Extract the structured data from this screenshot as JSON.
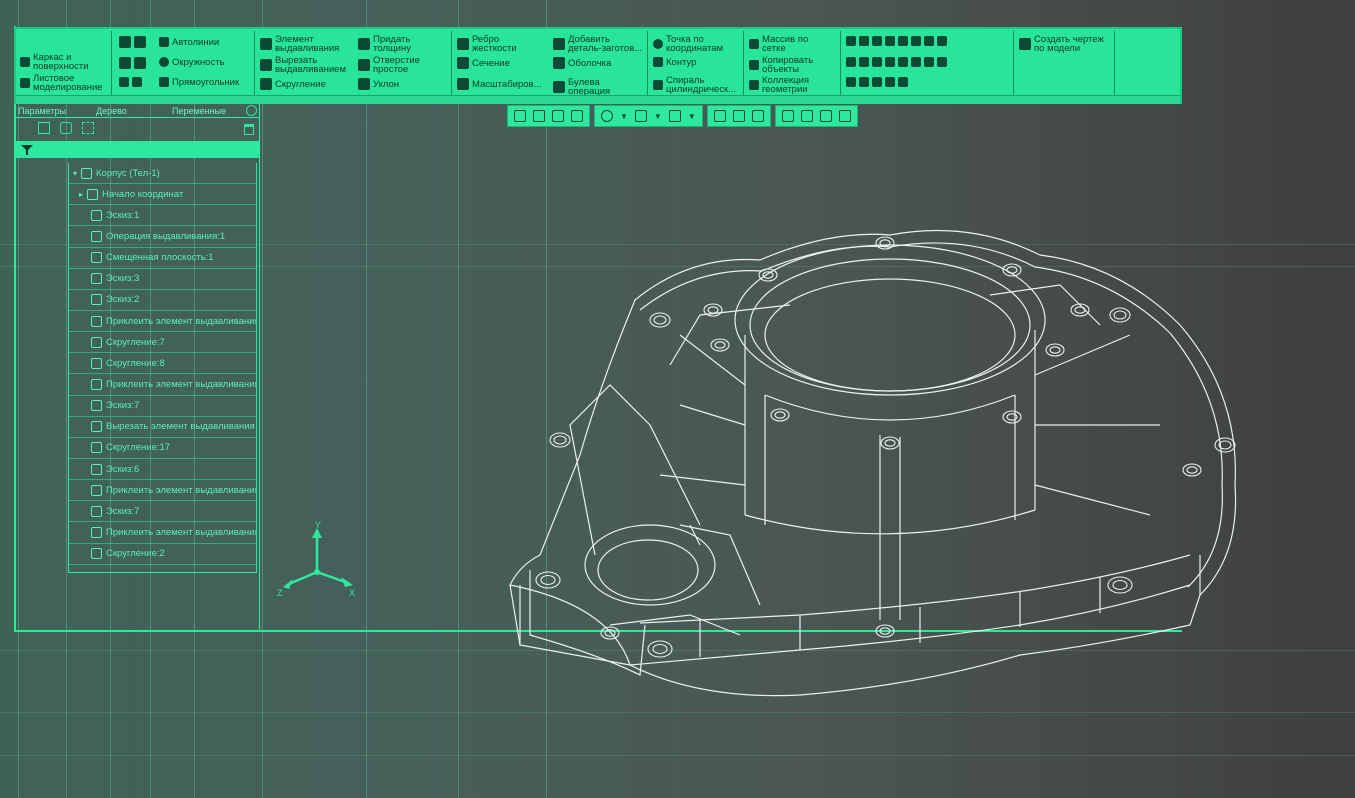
{
  "ribbon": {
    "sections": [
      {
        "items": [
          {
            "label": "Каркас и\nповерхности"
          },
          {
            "label": "Листовое\nмоделирование"
          }
        ]
      },
      {
        "items": [
          {
            "label": "Автолинии"
          },
          {
            "label": "Окружность"
          },
          {
            "label": "Прямоугольник"
          }
        ]
      },
      {
        "items": [
          {
            "label": "Элемент\nвыдавливания"
          },
          {
            "label": "Вырезать\nвыдавливанием"
          },
          {
            "label": "Скругление"
          },
          {
            "label": "Придать\nтолщину"
          },
          {
            "label": "Отверстие\nпростое"
          },
          {
            "label": "Уклон"
          }
        ]
      },
      {
        "items": [
          {
            "label": "Ребро\nжесткости"
          },
          {
            "label": "Сечение"
          },
          {
            "label": "Масштабиров..."
          },
          {
            "label": "Добавить\nдеталь-заготов..."
          },
          {
            "label": "Оболочка"
          },
          {
            "label": "Булева\nоперация"
          }
        ]
      },
      {
        "items": [
          {
            "label": "Точка по\nкоординатам"
          },
          {
            "label": "Контур"
          },
          {
            "label": "Спираль\nцилиндрическ..."
          }
        ]
      },
      {
        "items": [
          {
            "label": "Массив по\nсетке"
          },
          {
            "label": "Копировать\nобъекты"
          },
          {
            "label": "Коллекция\nгеометрии"
          }
        ]
      },
      {
        "items": [
          {
            "label": "Создать чертеж\nпо модели"
          }
        ]
      }
    ]
  },
  "panel": {
    "tabs": [
      "Параметры",
      "Дерево",
      "Переменные"
    ]
  },
  "tree": {
    "items": [
      {
        "label": "Корпус (Тел-1)",
        "icon": "part-icon"
      },
      {
        "label": "Начало координат",
        "icon": "origin-icon"
      },
      {
        "label": "Эскиз:1",
        "icon": "sketch-icon"
      },
      {
        "label": "Операция выдавливания:1",
        "icon": "extrude-icon"
      },
      {
        "label": "Смещенная плоскость:1",
        "icon": "plane-icon"
      },
      {
        "label": "Эскиз:3",
        "icon": "sketch-icon"
      },
      {
        "label": "Эскиз:2",
        "icon": "sketch-icon"
      },
      {
        "label": "Приклеить элемент выдавливания",
        "icon": "extrude-icon"
      },
      {
        "label": "Скругление:7",
        "icon": "fillet-icon"
      },
      {
        "label": "Скругление:8",
        "icon": "fillet-icon"
      },
      {
        "label": "Приклеить элемент выдавливания",
        "icon": "extrude-icon"
      },
      {
        "label": "Эскиз:7",
        "icon": "sketch-icon"
      },
      {
        "label": "Вырезать элемент выдавливания",
        "icon": "cut-icon"
      },
      {
        "label": "Скругление:17",
        "icon": "fillet-icon"
      },
      {
        "label": "Эскиз:6",
        "icon": "sketch-icon"
      },
      {
        "label": "Приклеить элемент выдавливания",
        "icon": "extrude-icon"
      },
      {
        "label": "Эскиз:7",
        "icon": "sketch-icon"
      },
      {
        "label": "Приклеить элемент выдавливания",
        "icon": "extrude-icon"
      },
      {
        "label": "Скругление:2",
        "icon": "fillet-icon"
      }
    ]
  },
  "axes": {
    "x": "X",
    "y": "Y",
    "z": "Z"
  },
  "colors": {
    "accent": "#2ee8a0",
    "wire": "#e8f1ee"
  }
}
